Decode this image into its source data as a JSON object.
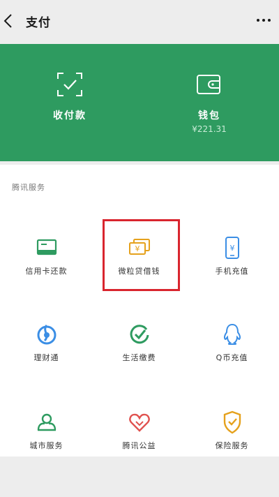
{
  "nav": {
    "title": "支付",
    "icons": {
      "back": "back-chevron-icon",
      "more": "more-dots-icon"
    }
  },
  "wallet_card": {
    "background": "#2e9b60",
    "items": [
      {
        "label": "收付款",
        "icon": "scan-check-icon"
      },
      {
        "label": "钱包",
        "balance": "¥221.31",
        "icon": "wallet-icon"
      }
    ]
  },
  "services": {
    "title": "腾讯服务",
    "items": [
      {
        "label": "信用卡还款",
        "icon": "credit-card-icon"
      },
      {
        "label": "微粒贷借钱",
        "icon": "loan-cash-icon"
      },
      {
        "label": "手机充值",
        "icon": "phone-topup-icon"
      },
      {
        "label": "理财通",
        "icon": "wealth-icon"
      },
      {
        "label": "生活缴费",
        "icon": "utility-check-icon"
      },
      {
        "label": "Q币充值",
        "icon": "qq-penguin-icon"
      },
      {
        "label": "城市服务",
        "icon": "city-service-icon"
      },
      {
        "label": "腾讯公益",
        "icon": "charity-heart-icon"
      },
      {
        "label": "保险服务",
        "icon": "insurance-shield-icon"
      }
    ]
  },
  "colors": {
    "green": "#2e9b60",
    "highlight": "#d9252e",
    "gold": "#e5a11c",
    "blue": "#3b8ee5",
    "red": "#e0524f"
  }
}
